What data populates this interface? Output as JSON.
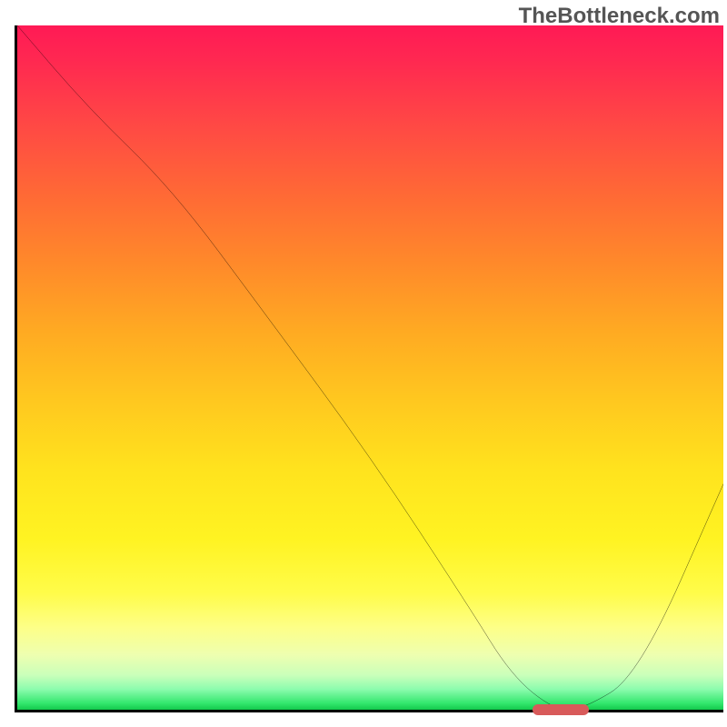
{
  "watermark": "TheBottleneck.com",
  "colors": {
    "gradient_top": "#ff1a55",
    "gradient_mid": "#ffd322",
    "gradient_bottom": "#13c94c",
    "line": "#000000",
    "marker": "#d85a5a",
    "axis": "#000000"
  },
  "chart_data": {
    "type": "line",
    "title": "",
    "xlabel": "",
    "ylabel": "",
    "xlim": [
      0,
      100
    ],
    "ylim": [
      0,
      100
    ],
    "x": [
      0,
      10,
      22,
      35,
      50,
      64,
      70,
      76,
      80,
      88,
      100
    ],
    "values": [
      100,
      88,
      76,
      58,
      37,
      15,
      5,
      0,
      0,
      5,
      33
    ],
    "marker": {
      "x_start": 73,
      "x_end": 81,
      "y": 0
    },
    "description": "V-shaped bottleneck curve overlaid on red-to-green vertical gradient; minimum (optimal point) near x≈77 marked by a small red pill on the x-axis."
  }
}
